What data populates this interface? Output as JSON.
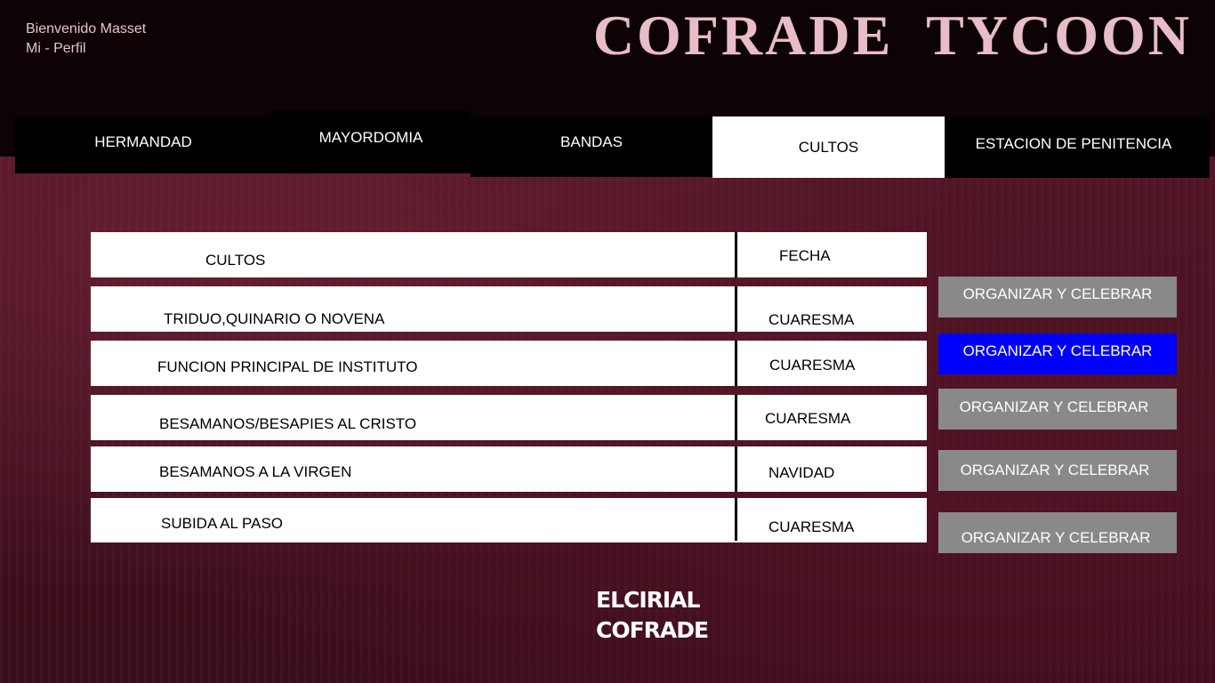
{
  "header": {
    "welcome": "Bienvenido Masset",
    "profile_link": "Mi - Perfil",
    "title": "COFRADE  TYCOON"
  },
  "tabs": [
    {
      "label": "HERMANDAD"
    },
    {
      "label": "MAYORDOMIA"
    },
    {
      "label": "BANDAS"
    },
    {
      "label": "CULTOS",
      "active": true
    },
    {
      "label": "ESTACION DE PENITENCIA"
    }
  ],
  "table": {
    "headers": [
      "CULTOS",
      "FECHA"
    ],
    "rows": [
      {
        "culto": "TRIDUO,QUINARIO O NOVENA",
        "fecha": "CUARESMA"
      },
      {
        "culto": "FUNCION PRINCIPAL DE INSTITUTO",
        "fecha": "CUARESMA"
      },
      {
        "culto": "BESAMANOS/BESAPIES AL CRISTO",
        "fecha": "CUARESMA"
      },
      {
        "culto": "BESAMANOS A LA VIRGEN",
        "fecha": "NAVIDAD"
      },
      {
        "culto": "SUBIDA AL PASO",
        "fecha": "CUARESMA"
      }
    ]
  },
  "actions": [
    {
      "label": "ORGANIZAR Y CELEBRAR"
    },
    {
      "label": "ORGANIZAR Y CELEBRAR",
      "highlighted": true
    },
    {
      "label": "ORGANIZAR Y CELEBRAR"
    },
    {
      "label": "ORGANIZAR Y CELEBRAR"
    },
    {
      "label": "ORGANIZAR Y CELEBRAR"
    }
  ],
  "footer": {
    "logo_line1": "ELCIRIAL",
    "logo_line2": "COFRADE"
  },
  "colors": {
    "accent": "#0000ff",
    "button_gray": "#898989",
    "title_pink": "#e8bcc8",
    "background": "#4a1222"
  }
}
